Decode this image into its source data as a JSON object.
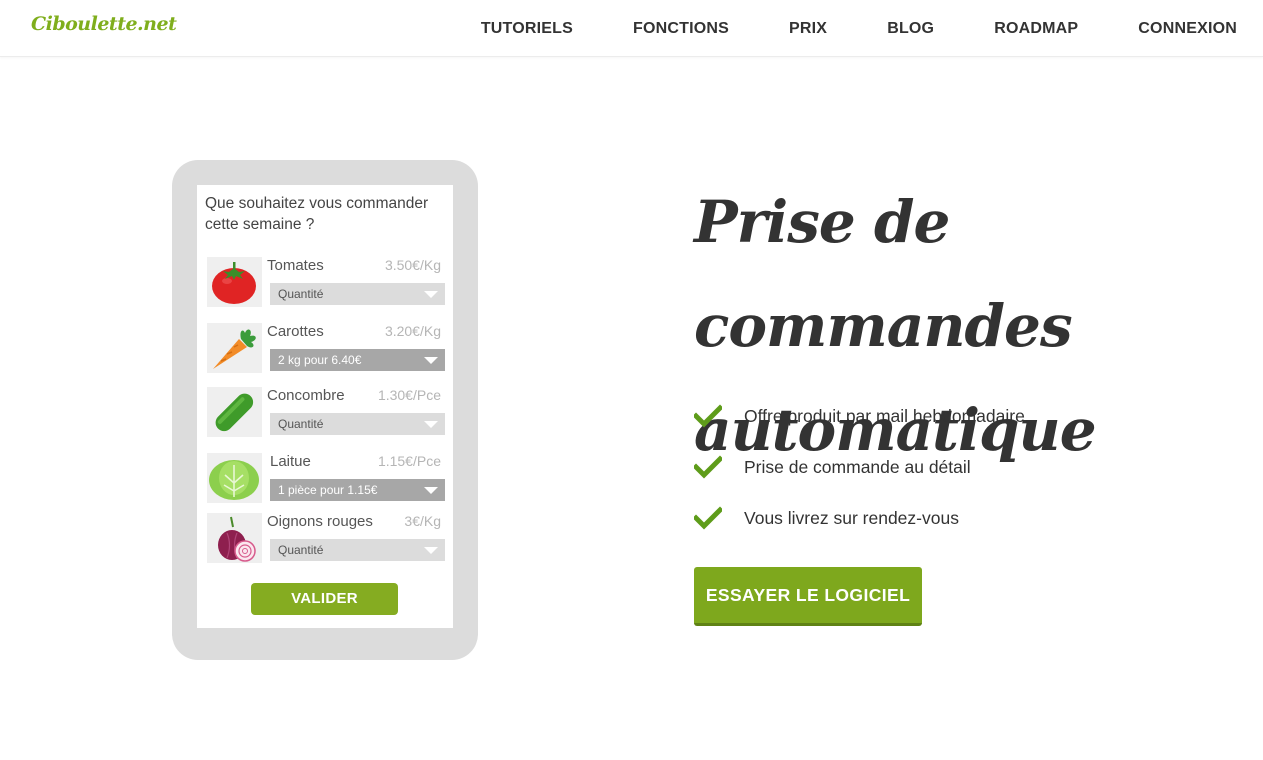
{
  "brand": {
    "logo": "Ciboulette.net",
    "accent_color": "#7ea81d"
  },
  "nav": {
    "items": [
      {
        "label": "TUTORIELS"
      },
      {
        "label": "FONCTIONS"
      },
      {
        "label": "PRIX"
      },
      {
        "label": "BLOG"
      },
      {
        "label": "ROADMAP"
      },
      {
        "label": "CONNEXION"
      }
    ]
  },
  "order_form": {
    "question": "Que souhaitez vous commander cette semaine ?",
    "products": [
      {
        "name": "Tomates",
        "price": "3.50€/Kg",
        "quantity": "Quantité",
        "icon": "tomato-icon"
      },
      {
        "name": "Carottes",
        "price": "3.20€/Kg",
        "quantity": "2 kg pour 6.40€",
        "icon": "carrot-icon"
      },
      {
        "name": "Concombre",
        "price": "1.30€/Pce",
        "quantity": "Quantité",
        "icon": "cucumber-icon"
      },
      {
        "name": "Laitue",
        "price": "1.15€/Pce",
        "quantity": "1 pièce pour 1.15€",
        "icon": "lettuce-icon"
      },
      {
        "name": "Oignons rouges",
        "price": "3€/Kg",
        "quantity": "Quantité",
        "icon": "red-onion-icon"
      }
    ],
    "submit_label": "VALIDER"
  },
  "hero": {
    "title_line1": "Prise de commandes",
    "title_line2": "automatique",
    "features": [
      {
        "text": "Offre produit par mail hebdomadaire.",
        "icon": "checkmark-icon"
      },
      {
        "text": "Prise de commande au détail",
        "icon": "checkmark-icon"
      },
      {
        "text": "Vous livrez sur rendez-vous",
        "icon": "checkmark-icon"
      }
    ],
    "cta_label": "ESSAYER LE LOGICIEL"
  }
}
